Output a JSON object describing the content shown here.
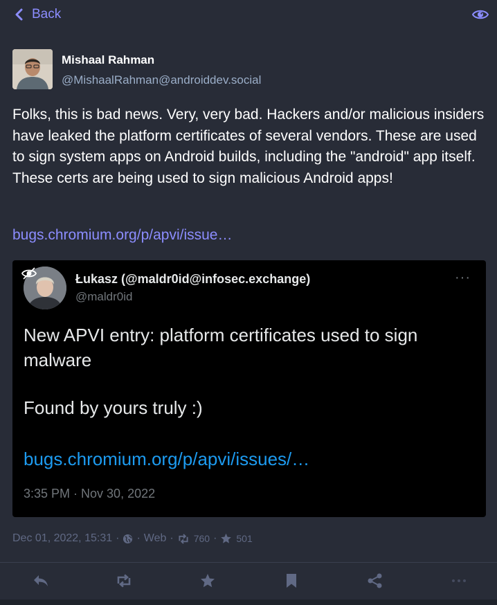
{
  "header": {
    "back_label": "Back"
  },
  "author": {
    "display_name": "Mishaal Rahman",
    "acct": "@MishaalRahman@androiddev.social"
  },
  "status": {
    "text": "Folks, this is bad news. Very, very bad. Hackers and/or malicious insiders have leaked the platform certificates of several vendors. These are used to sign system apps on Android builds, including the \"android\" app itself. These certs are being used to sign malicious Android apps!",
    "link_text": "bugs.chromium.org/p/apvi/issue…"
  },
  "embedded": {
    "name": "Łukasz (@maldr0id@infosec.exchange)",
    "handle": "@maldr0id",
    "more": "···",
    "text_line1": "New APVI entry: platform certificates used to sign malware",
    "text_line2": "Found by yours truly :)",
    "link": "bugs.chromium.org/p/apvi/issues/…",
    "time": "3:35 PM · Nov 30, 2022"
  },
  "meta": {
    "date": "Dec 01, 2022, 15:31",
    "app": "Web",
    "reblogs": "760",
    "favourites": "501"
  },
  "colors": {
    "background": "#282c37",
    "accent": "#8c8dff",
    "muted": "#606984",
    "secondary_text": "#9baec8",
    "embedded_link": "#1d9bf0"
  }
}
